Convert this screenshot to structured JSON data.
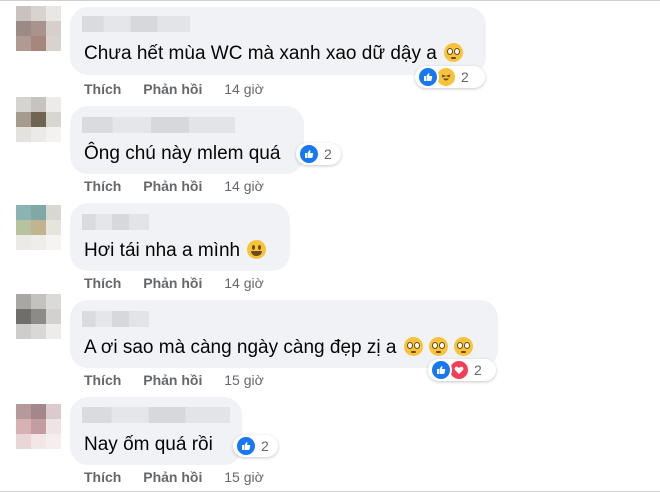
{
  "comments": [
    {
      "text": "Chưa hết mùa WC mà xanh xao dữ dậy a",
      "reaction_count": "2",
      "reaction_types": [
        "like",
        "haha"
      ],
      "like_label": "Thích",
      "reply_label": "Phản hồi",
      "time": "14 giờ",
      "avatar_colors": [
        "#c9c2bf",
        "#d8d3cf",
        "#e9e6e3",
        "#9b8a85",
        "#a8938d",
        "#d6cfcc",
        "#b19a91",
        "#a5877c",
        "#d9d3d0"
      ]
    },
    {
      "text": "Ông chú này mlem quá",
      "reaction_count": "2",
      "reaction_types": [
        "like"
      ],
      "like_label": "Thích",
      "reply_label": "Phản hồi",
      "time": "14 giờ",
      "avatar_colors": [
        "#d6d4d1",
        "#c7c4c0",
        "#ecebe9",
        "#a59c8f",
        "#6f6552",
        "#d9d6d2",
        "#e3e2df",
        "#ebeae8",
        "#f3f2f1"
      ]
    },
    {
      "text": "Hơi tái nha a mình",
      "reaction_count": "",
      "reaction_types": [],
      "like_label": "Thích",
      "reply_label": "Phản hồi",
      "time": "14 giờ",
      "avatar_colors": [
        "#8cb3b4",
        "#7fa8a6",
        "#dad7d2",
        "#b7c39e",
        "#c3b490",
        "#e7e4de",
        "#eceae6",
        "#efede9",
        "#f5f4f2"
      ]
    },
    {
      "text": "A ơi sao mà càng ngày càng đẹp zị a",
      "reaction_count": "2",
      "reaction_types": [
        "like",
        "love"
      ],
      "like_label": "Thích",
      "reply_label": "Phản hồi",
      "time": "15 giờ",
      "avatar_colors": [
        "#a9a7a4",
        "#c4c2bf",
        "#dcdad8",
        "#6f6e6a",
        "#8d8b88",
        "#d3d1cf",
        "#cfcdcb",
        "#dad8d6",
        "#eeeceb"
      ]
    },
    {
      "text": "Nay ốm quá rồi",
      "reaction_count": "2",
      "reaction_types": [
        "like"
      ],
      "like_label": "Thích",
      "reply_label": "Phản hồi",
      "time": "15 giờ",
      "avatar_colors": [
        "#b5999b",
        "#a4878b",
        "#dccbcc",
        "#d8b1b3",
        "#c39ea0",
        "#efe4e4",
        "#ebd6d7",
        "#f2e6e6",
        "#f6eeee"
      ]
    }
  ],
  "emoji_after": [
    "pleading",
    "",
    "grin",
    "pleading pleading pleading",
    ""
  ],
  "icons": {
    "like": "thumbs-up-icon",
    "haha": "haha-face-icon",
    "love": "heart-icon"
  },
  "colors": {
    "bubble": "#f0f2f5",
    "like": "#1877f2",
    "love": "#f33e58",
    "haha": "#f7c33b",
    "meta": "#65676b"
  }
}
